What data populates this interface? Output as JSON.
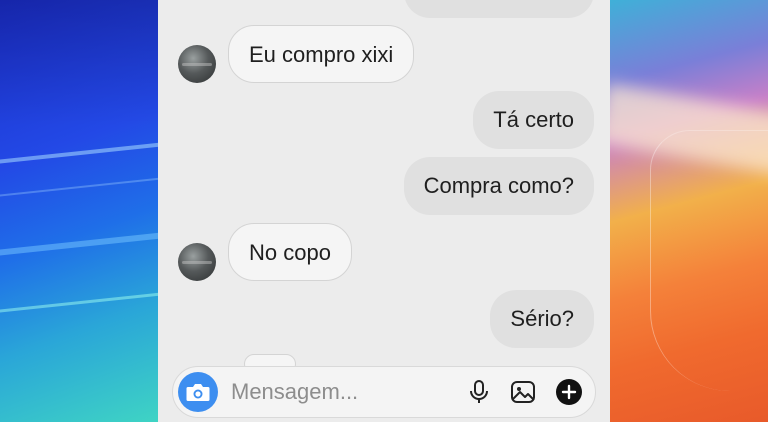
{
  "conversation": {
    "messages": [
      {
        "sender": "other",
        "text": "Eu compro xixi"
      },
      {
        "sender": "me",
        "text": "Tá certo"
      },
      {
        "sender": "me",
        "text": "Compra como?"
      },
      {
        "sender": "other",
        "text": "No copo"
      },
      {
        "sender": "me",
        "text": "Sério?"
      }
    ]
  },
  "composer": {
    "placeholder": "Mensagem...",
    "icons": [
      "camera-icon",
      "microphone-icon",
      "gallery-icon",
      "plus-icon"
    ]
  },
  "colors": {
    "accent": "#3d8ef0",
    "bubble_me": "#e0e0e0",
    "bubble_other": "#f5f5f5",
    "background": "#ececec"
  }
}
